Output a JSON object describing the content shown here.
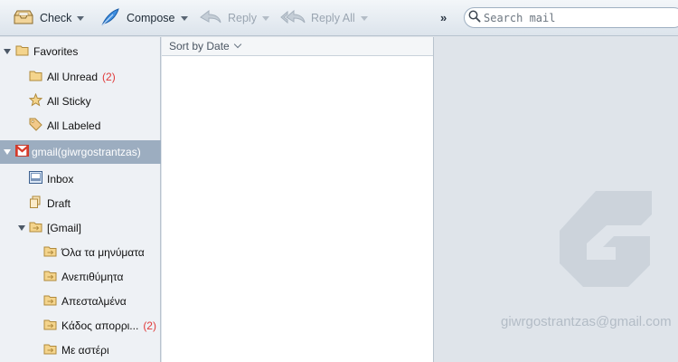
{
  "toolbar": {
    "check_label": "Check",
    "compose_label": "Compose",
    "reply_label": "Reply",
    "reply_all_label": "Reply All",
    "more_label": "»",
    "search_placeholder": "Search mail"
  },
  "sidebar": {
    "favorites": {
      "label": "Favorites",
      "items": [
        {
          "label": "All Unread",
          "count": "(2)"
        },
        {
          "label": "All Sticky"
        },
        {
          "label": "All Labeled"
        }
      ]
    },
    "account": {
      "label": "gmail(giwrgostrantzas)",
      "items": [
        {
          "label": "Inbox"
        },
        {
          "label": "Draft"
        },
        {
          "label": "[Gmail]"
        }
      ],
      "gmail_children": [
        {
          "label": "Όλα τα μηνύματα"
        },
        {
          "label": "Ανεπιθύμητα"
        },
        {
          "label": "Απεσταλμένα"
        },
        {
          "label": "Κάδος απορρι...",
          "count": "(2)"
        },
        {
          "label": "Με αστέρι"
        }
      ]
    }
  },
  "list": {
    "sort_label": "Sort by Date"
  },
  "reading": {
    "account_email": "giwrgostrantzas@gmail.com"
  },
  "colors": {
    "accent": "#1b6fd1",
    "unread_count": "#e03a3a",
    "selected_row": "#9cadc0"
  }
}
